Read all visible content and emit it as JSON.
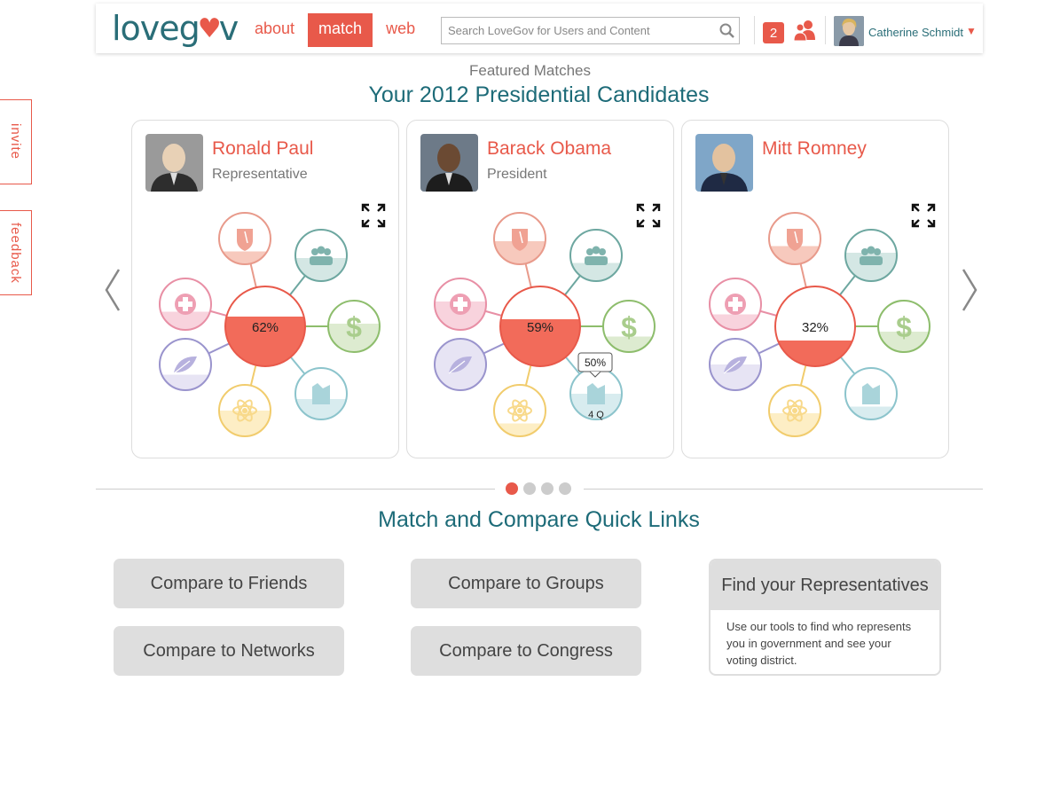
{
  "side_tabs": {
    "invite": "invite",
    "feedback": "feedback"
  },
  "header": {
    "logo_text_a": "loveg",
    "logo_text_b": "v",
    "nav": {
      "about": "about",
      "match": "match",
      "web": "web"
    },
    "search_placeholder": "Search LoveGov for Users and Content",
    "notification_count": "2",
    "user_name": "Catherine Schmidt"
  },
  "featured_label": "Featured Matches",
  "main_title": "Your 2012 Presidential Candidates",
  "candidates": [
    {
      "name": "Ronald Paul",
      "title": "Representative",
      "match": "62%",
      "match_fraction": 0.62
    },
    {
      "name": "Barack Obama",
      "title": "President",
      "match": "59%",
      "match_fraction": 0.59,
      "tooltip_value": "50%",
      "tooltip_sub": "4 Q"
    },
    {
      "name": "Mitt Romney",
      "title": "",
      "match": "32%",
      "match_fraction": 0.32
    }
  ],
  "pager": {
    "count": 4,
    "active": 0
  },
  "quick_links_title": "Match and Compare Quick Links",
  "quick_links": {
    "friends": "Compare to Friends",
    "groups": "Compare to Groups",
    "networks": "Compare to Networks",
    "congress": "Compare to Congress"
  },
  "representatives": {
    "title": "Find your Representatives",
    "description": "Use our tools to find who represents you in government and see your voting district."
  },
  "colors": {
    "accent": "#e8594a",
    "teal": "#1d6b78"
  }
}
